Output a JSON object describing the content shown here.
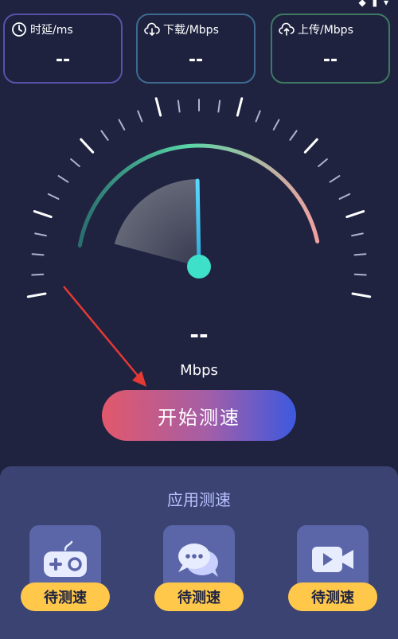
{
  "status_bar": {
    "icons": "◆ ▮ ▾"
  },
  "metrics": {
    "latency": {
      "label": "时延/ms",
      "value": "--",
      "accent": "#5b50a8"
    },
    "download": {
      "label": "下载/Mbps",
      "value": "--",
      "accent": "#3c6a90"
    },
    "upload": {
      "label": "上传/Mbps",
      "value": "--",
      "accent": "#3e7a62"
    }
  },
  "gauge": {
    "value": "--",
    "unit": "Mbps",
    "needle_fraction": 0.5
  },
  "start_button": {
    "label": "开始测速",
    "gradient": [
      "#e2586b",
      "#3c59df"
    ]
  },
  "app_speed": {
    "title": "应用测速",
    "items": [
      {
        "icon": "gamepad-icon",
        "status": "待测速"
      },
      {
        "icon": "chat-icon",
        "status": "待测速"
      },
      {
        "icon": "video-icon",
        "status": "待测速"
      }
    ]
  },
  "colors": {
    "background": "#1f2340",
    "panel": "#3b4372",
    "pill": "#ffc84a",
    "annotation_arrow": "#e53935"
  }
}
